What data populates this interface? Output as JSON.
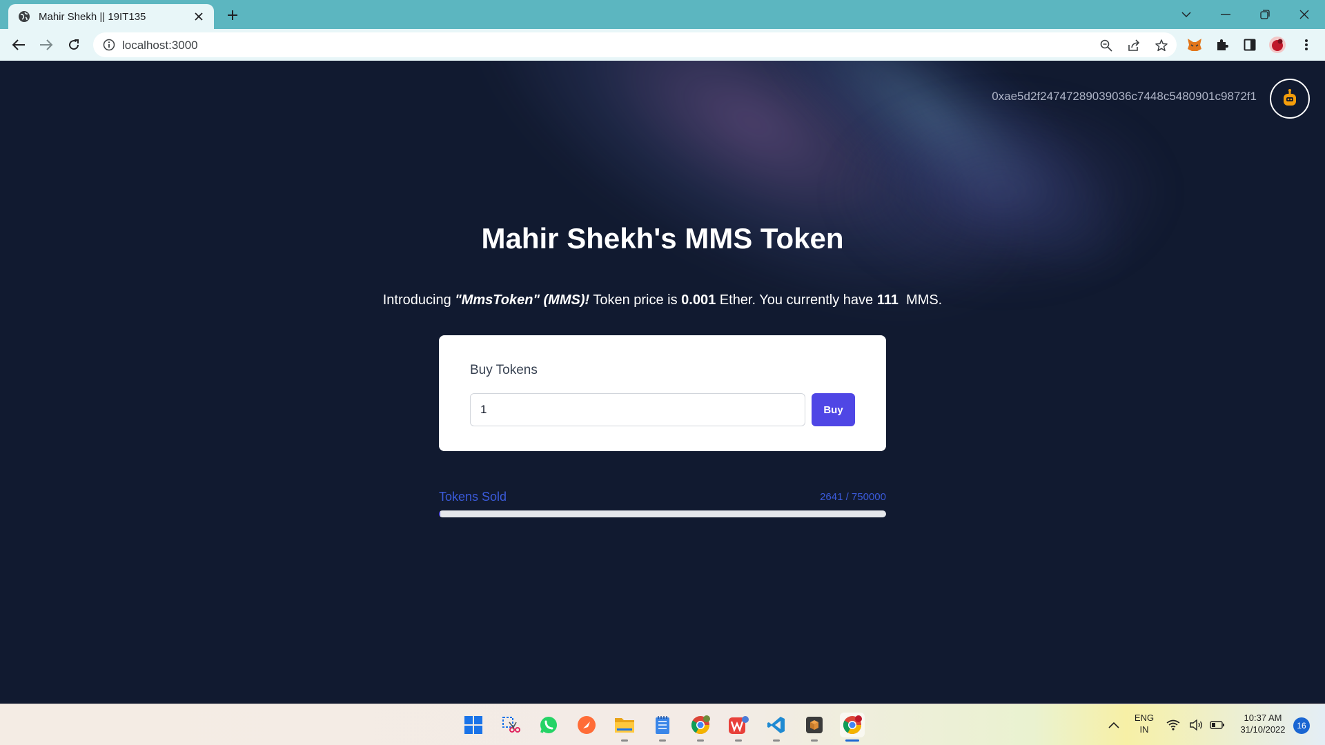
{
  "browser": {
    "tab_title": "Mahir Shekh || 19IT135",
    "url": "localhost:3000"
  },
  "page": {
    "account_address": "0xae5d2f24747289039036c7448c5480901c9872f1",
    "title": "Mahir Shekh's MMS Token",
    "intro": {
      "prefix": "Introducing ",
      "token_name": "\"MmsToken\" (MMS)!",
      "price_prefix": " Token price is ",
      "price": "0.001",
      "price_suffix": " Ether. You currently have ",
      "balance": "111",
      "balance_suffix": "  MMS."
    },
    "buy_card": {
      "heading": "Buy Tokens",
      "quantity_value": "1",
      "buy_label": "Buy"
    },
    "tokens_sold": {
      "label": "Tokens Sold",
      "count_text": "2641 / 750000",
      "sold": 2641,
      "total": 750000
    }
  },
  "taskbar": {
    "language": "ENG",
    "region": "IN",
    "time": "10:37 AM",
    "date": "31/10/2022",
    "notifications": "16"
  },
  "colors": {
    "page_bg": "#111a30",
    "accent": "#4f46e5",
    "tab_bar": "#5cb6c0"
  }
}
